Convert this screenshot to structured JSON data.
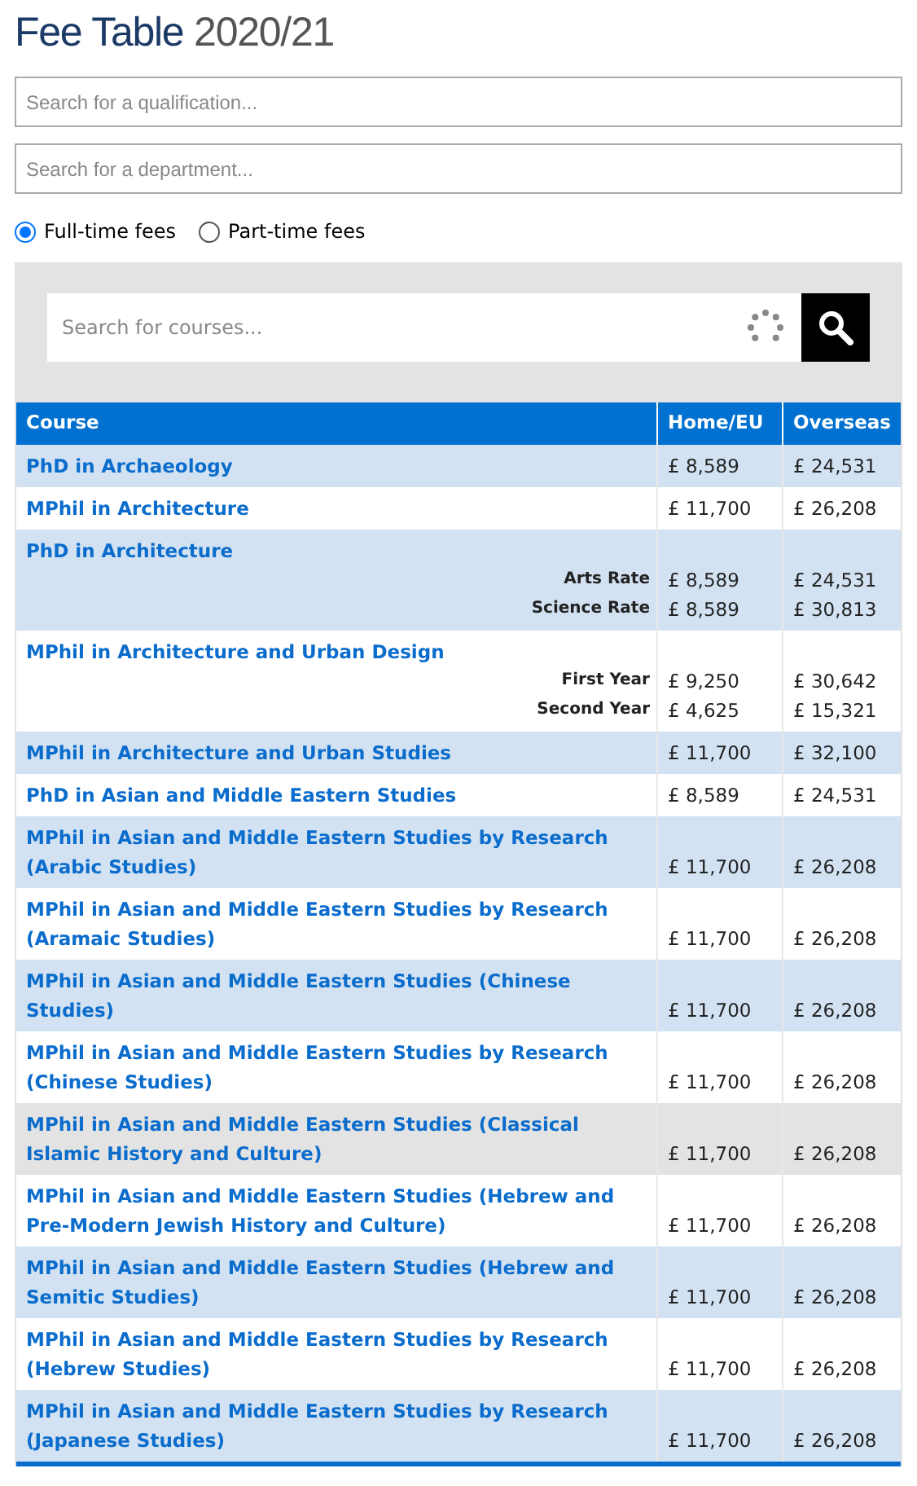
{
  "title": {
    "main": "Fee Table",
    "year": "2020/21"
  },
  "filters": [
    {
      "placeholder": "Search for a qualification..."
    },
    {
      "placeholder": "Search for a department..."
    }
  ],
  "fee_modes": [
    {
      "label": "Full-time fees",
      "selected": true
    },
    {
      "label": "Part-time fees",
      "selected": false
    }
  ],
  "course_search": {
    "placeholder": "Search for courses...",
    "loading": true
  },
  "table": {
    "columns": [
      "Course",
      "Home/EU",
      "Overseas"
    ],
    "rows": [
      {
        "kind": "single",
        "course": "PhD in Archaeology",
        "home": "£ 8,589",
        "overseas": "£ 24,531",
        "highlighted": false
      },
      {
        "kind": "single",
        "course": "MPhil in Architecture",
        "home": "£ 11,700",
        "overseas": "£ 26,208",
        "highlighted": false
      },
      {
        "kind": "rates",
        "course": "PhD in Architecture",
        "rates": [
          {
            "label": "Arts Rate",
            "home": "£ 8,589",
            "overseas": "£ 24,531"
          },
          {
            "label": "Science Rate",
            "home": "£ 8,589",
            "overseas": "£ 30,813"
          }
        ],
        "highlighted": false
      },
      {
        "kind": "rates",
        "course": "MPhil in Architecture and Urban Design",
        "rates": [
          {
            "label": "First Year",
            "home": "£ 9,250",
            "overseas": "£ 30,642"
          },
          {
            "label": "Second Year",
            "home": "£ 4,625",
            "overseas": "£ 15,321"
          }
        ],
        "highlighted": false
      },
      {
        "kind": "single",
        "course": "MPhil in Architecture and Urban Studies",
        "home": "£ 11,700",
        "overseas": "£ 32,100",
        "highlighted": false
      },
      {
        "kind": "single",
        "course": "PhD in Asian and Middle Eastern Studies",
        "home": "£ 8,589",
        "overseas": "£ 24,531",
        "highlighted": false
      },
      {
        "kind": "single",
        "course": "MPhil in Asian and Middle Eastern Studies by Research (Arabic Studies)",
        "home": "£ 11,700",
        "overseas": "£ 26,208",
        "highlighted": false
      },
      {
        "kind": "single",
        "course": "MPhil in Asian and Middle Eastern Studies by Research (Aramaic Studies)",
        "home": "£ 11,700",
        "overseas": "£ 26,208",
        "highlighted": false
      },
      {
        "kind": "single",
        "course": "MPhil in Asian and Middle Eastern Studies (Chinese Studies)",
        "home": "£ 11,700",
        "overseas": "£ 26,208",
        "highlighted": false
      },
      {
        "kind": "single",
        "course": "MPhil in Asian and Middle Eastern Studies by Research (Chinese Studies)",
        "home": "£ 11,700",
        "overseas": "£ 26,208",
        "highlighted": false
      },
      {
        "kind": "single",
        "course": "MPhil in Asian and Middle Eastern Studies (Classical Islamic History and Culture)",
        "home": "£ 11,700",
        "overseas": "£ 26,208",
        "highlighted": true
      },
      {
        "kind": "single",
        "course": "MPhil in Asian and Middle Eastern Studies (Hebrew and Pre-Modern Jewish History and Culture)",
        "home": "£ 11,700",
        "overseas": "£ 26,208",
        "highlighted": false
      },
      {
        "kind": "single",
        "course": "MPhil in Asian and Middle Eastern Studies (Hebrew and Semitic Studies)",
        "home": "£ 11,700",
        "overseas": "£ 26,208",
        "highlighted": false
      },
      {
        "kind": "single",
        "course": "MPhil in Asian and Middle Eastern Studies by Research (Hebrew Studies)",
        "home": "£ 11,700",
        "overseas": "£ 26,208",
        "highlighted": false
      },
      {
        "kind": "single",
        "course": "MPhil in Asian and Middle Eastern Studies by Research (Japanese Studies)",
        "home": "£ 11,700",
        "overseas": "£ 26,208",
        "highlighted": false
      }
    ]
  }
}
